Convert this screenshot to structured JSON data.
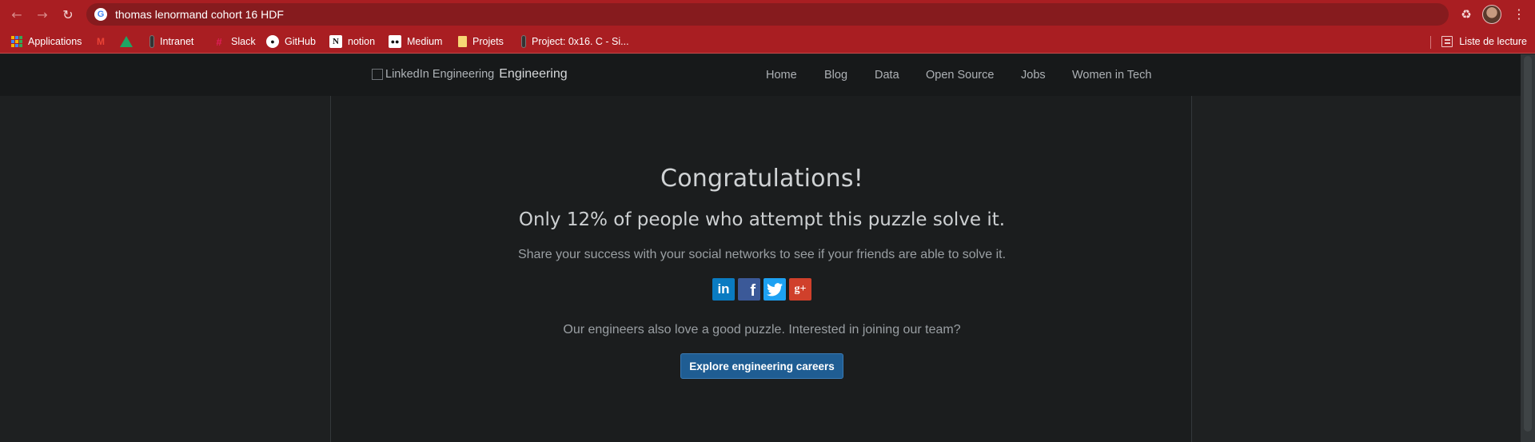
{
  "browser": {
    "nav": {
      "back_icon": "arrow-left",
      "forward_icon": "arrow-right",
      "reload_icon": "reload"
    },
    "omnibox": {
      "text": "thomas lenormand cohort 16 HDF",
      "icon": "google-g"
    },
    "bookmarks": [
      {
        "label": "Applications",
        "icon": "apps-grid-icon"
      },
      {
        "label": "",
        "icon": "gmail-icon"
      },
      {
        "label": "",
        "icon": "drive-icon"
      },
      {
        "label": "Intranet",
        "icon": "bookmark-favicon"
      },
      {
        "label": "Slack",
        "icon": "slack-icon"
      },
      {
        "label": "GitHub",
        "icon": "github-icon"
      },
      {
        "label": "notion",
        "icon": "notion-icon"
      },
      {
        "label": "Medium",
        "icon": "medium-icon"
      },
      {
        "label": "Projets",
        "icon": "folder-icon"
      },
      {
        "label": "Project: 0x16. C - Si...",
        "icon": "bookmark-favicon"
      }
    ],
    "reading_list": "Liste de lecture",
    "chrome_color": "#a91e22"
  },
  "site": {
    "logo_alt": "LinkedIn Engineering",
    "logo_suffix": "Engineering",
    "nav": [
      "Home",
      "Blog",
      "Data",
      "Open Source",
      "Jobs",
      "Women in Tech"
    ]
  },
  "content": {
    "title": "Congratulations!",
    "subtitle": "Only 12% of people who attempt this puzzle solve it.",
    "share_text": "Share your success with your social networks to see if your friends are able to solve it.",
    "social": [
      {
        "name": "linkedin-icon",
        "glyph": "in",
        "color": "#0a7bc1"
      },
      {
        "name": "facebook-icon",
        "glyph": "f",
        "color": "#3b5998"
      },
      {
        "name": "twitter-icon",
        "glyph": "",
        "color": "#1da1f2"
      },
      {
        "name": "google-plus-icon",
        "glyph": "g+",
        "color": "#d0402b"
      }
    ],
    "engineers_text": "Our engineers also love a good puzzle. Interested in joining our team?",
    "cta_label": "Explore engineering careers",
    "cta_color": "#1f5d93"
  }
}
